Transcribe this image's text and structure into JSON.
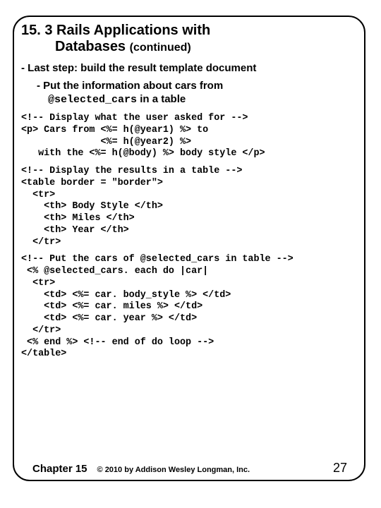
{
  "title": {
    "line1": "15. 3 Rails Applications with",
    "line2_word": "Databases",
    "line2_cont": "(continued)"
  },
  "bullet_last_step": "- Last step: build the result template document",
  "bullet_put_info": "- Put the information about cars from",
  "bullet_put_info_sub_var": "@selected_cars",
  "bullet_put_info_sub_rest": " in a table",
  "code_block1": "<!-- Display what the user asked for -->\n<p> Cars from <%= h(@year1) %> to\n              <%= h(@year2) %>\n   with the <%= h(@body) %> body style </p>",
  "code_block2": "<!-- Display the results in a table -->\n<table border = \"border\">\n  <tr>\n    <th> Body Style </th>\n    <th> Miles </th>\n    <th> Year </th>\n  </tr>",
  "code_block3": "<!-- Put the cars of @selected_cars in table -->\n <% @selected_cars. each do |car|\n  <tr>\n    <td> <%= car. body_style %> </td>\n    <td> <%= car. miles %> </td>\n    <td> <%= car. year %> </td>\n  </tr>\n <% end %> <!-- end of do loop -->\n</table>",
  "footer": {
    "chapter": "Chapter 15",
    "copyright": "© 2010 by Addison Wesley Longman, Inc.",
    "page": "27"
  }
}
